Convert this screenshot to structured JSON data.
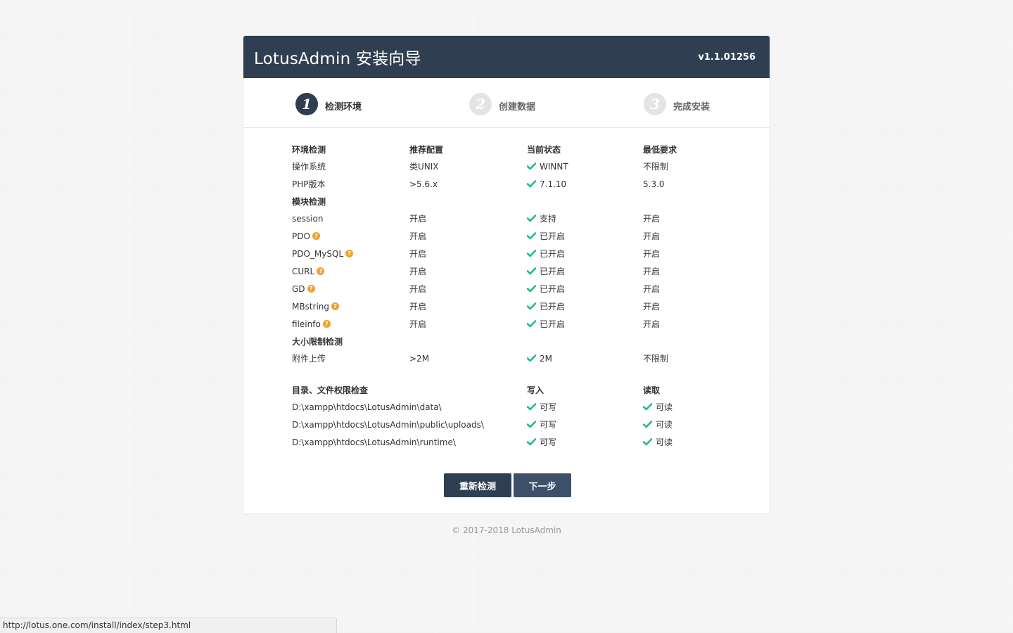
{
  "header": {
    "title": "LotusAdmin 安装向导",
    "version": "v1.1.01256"
  },
  "steps": [
    {
      "num": "1",
      "label": "检测环境"
    },
    {
      "num": "2",
      "label": "创建数据"
    },
    {
      "num": "3",
      "label": "完成安装"
    }
  ],
  "env": {
    "headers": [
      "环境检测",
      "推荐配置",
      "当前状态",
      "最低要求"
    ],
    "rows": [
      {
        "name": "操作系统",
        "recommended": "类UNIX",
        "status": "WINNT",
        "min": "不限制"
      },
      {
        "name": "PHP版本",
        "recommended": ">5.6.x",
        "status": "7.1.10",
        "min": "5.3.0"
      }
    ]
  },
  "modules": {
    "title": "模块检测",
    "rows": [
      {
        "name": "session",
        "recommended": "开启",
        "status": "支持",
        "min": "开启",
        "help": false
      },
      {
        "name": "PDO",
        "recommended": "开启",
        "status": "已开启",
        "min": "开启",
        "help": true
      },
      {
        "name": "PDO_MySQL",
        "recommended": "开启",
        "status": "已开启",
        "min": "开启",
        "help": true
      },
      {
        "name": "CURL",
        "recommended": "开启",
        "status": "已开启",
        "min": "开启",
        "help": true
      },
      {
        "name": "GD",
        "recommended": "开启",
        "status": "已开启",
        "min": "开启",
        "help": true
      },
      {
        "name": "MBstring",
        "recommended": "开启",
        "status": "已开启",
        "min": "开启",
        "help": true
      },
      {
        "name": "fileinfo",
        "recommended": "开启",
        "status": "已开启",
        "min": "开启",
        "help": true
      }
    ]
  },
  "size": {
    "title": "大小限制检测",
    "rows": [
      {
        "name": "附件上传",
        "recommended": ">2M",
        "status": "2M",
        "min": "不限制"
      }
    ]
  },
  "dirs": {
    "headers": [
      "目录、文件权限检查",
      "写入",
      "读取"
    ],
    "rows": [
      {
        "path": "D:\\xampp\\htdocs\\LotusAdmin\\data\\",
        "write": "可写",
        "read": "可读"
      },
      {
        "path": "D:\\xampp\\htdocs\\LotusAdmin\\public\\uploads\\",
        "write": "可写",
        "read": "可读"
      },
      {
        "path": "D:\\xampp\\htdocs\\LotusAdmin\\runtime\\",
        "write": "可写",
        "read": "可读"
      }
    ]
  },
  "buttons": {
    "recheck": "重新检测",
    "next": "下一步"
  },
  "footer": "© 2017-2018 LotusAdmin",
  "statusbar": "http://lotus.one.com/install/index/step3.html",
  "icons": {
    "check": "check-icon",
    "help": "question-circle-icon"
  },
  "colors": {
    "header": "#2f3e50",
    "check": "#1abc9c",
    "help": "#f0a030"
  }
}
